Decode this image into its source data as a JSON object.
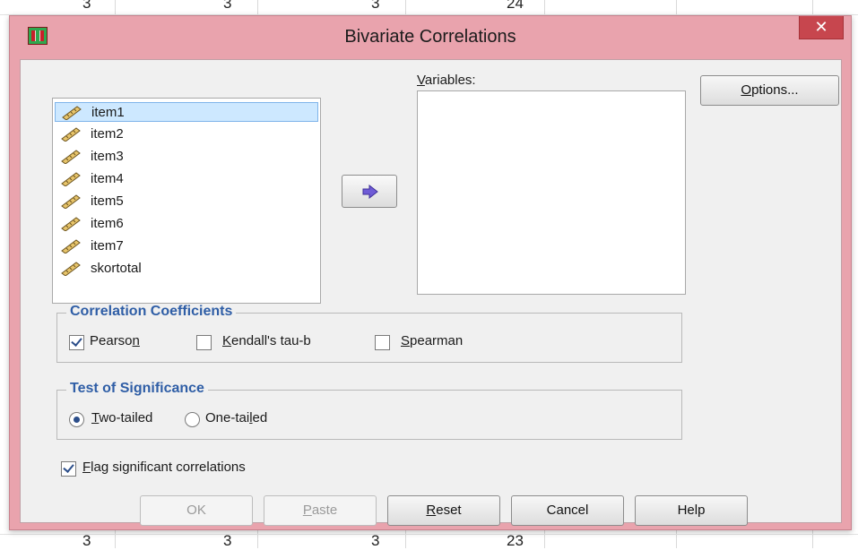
{
  "sheet": {
    "top_values": [
      "3",
      "3",
      "3",
      "24"
    ],
    "bottom_values": [
      "3",
      "3",
      "3",
      "23"
    ]
  },
  "dialog": {
    "title": "Bivariate Correlations",
    "close_glyph": "✕"
  },
  "source_list": {
    "items": [
      "item1",
      "item2",
      "item3",
      "item4",
      "item5",
      "item6",
      "item7",
      "skortotal"
    ],
    "selected": "item1"
  },
  "move_button": {
    "icon": "arrow-right-icon"
  },
  "variables": {
    "label_underlined": "V",
    "label_rest": "ariables:"
  },
  "options_button": {
    "underlined": "O",
    "rest": "ptions..."
  },
  "correlation_coefficients": {
    "title": "Correlation Coefficients",
    "pearson": {
      "text_pre": "Pearso",
      "underlined": "n",
      "checked": true
    },
    "kendall": {
      "underlined": "K",
      "text_post": "endall's tau-b",
      "checked": false
    },
    "spearman": {
      "underlined": "S",
      "text_post": "pearman",
      "checked": false
    }
  },
  "test_of_significance": {
    "title": "Test of Significance",
    "two_tailed": {
      "underlined": "T",
      "text_post": "wo-tailed",
      "selected": true
    },
    "one_tailed": {
      "text_pre": "One-tai",
      "underlined": "l",
      "text_post": "ed",
      "selected": false
    }
  },
  "flag": {
    "underlined": "F",
    "text_post": "lag significant correlations",
    "checked": true
  },
  "buttons": {
    "ok": "OK",
    "paste_underlined": "P",
    "paste_rest": "aste",
    "reset_underlined": "R",
    "reset_rest": "eset",
    "cancel": "Cancel",
    "help": "Help"
  },
  "colors": {
    "frame": "#e9a3ad",
    "close": "#c7464e",
    "group_title": "#2f5ea6",
    "selection": "#cde8ff"
  }
}
